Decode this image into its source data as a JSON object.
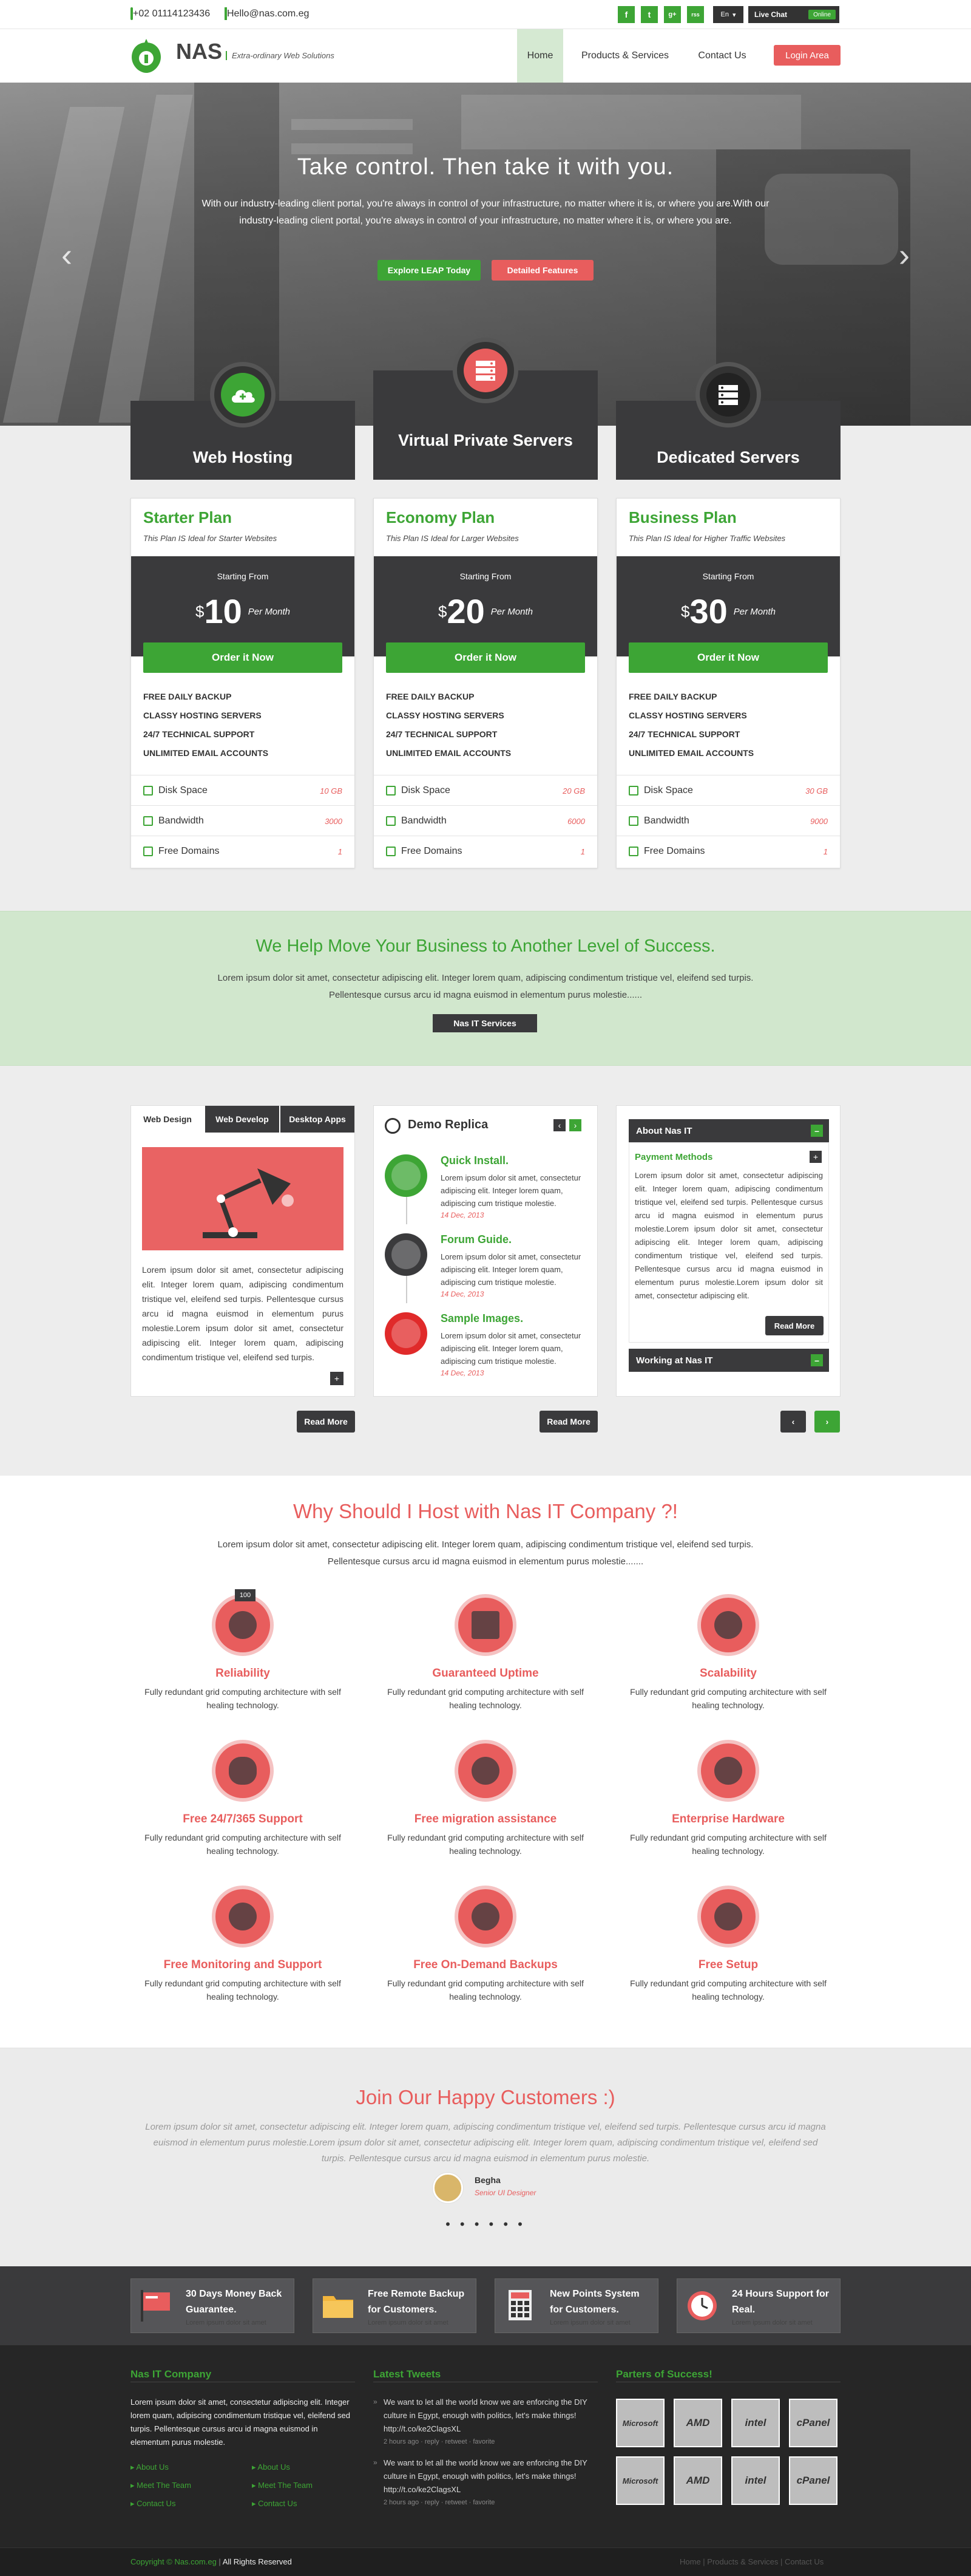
{
  "topbar": {
    "phone": "+02 01114123436",
    "email": "Hello@nas.com.eg",
    "social": [
      "f",
      "t",
      "g+",
      "rss"
    ],
    "language": "En",
    "live_chat": "Live Chat",
    "status": "Online"
  },
  "nav": {
    "logo": "NAS",
    "tagline": "Extra-ordinary Web Solutions",
    "items": [
      "Home",
      "Products & Services",
      "Contact Us"
    ],
    "login": "Login Area"
  },
  "hero": {
    "title": "Take control. Then take it with you.",
    "text": "With our industry-leading client portal, you're always in control of your infrastructure, no matter where it is, or where you are.With our industry-leading client portal, you're always in control of your infrastructure, no matter where it is, or where you are.",
    "btn_primary": "Explore LEAP Today",
    "btn_secondary": "Detailed Features"
  },
  "plans": [
    {
      "category": "Web Hosting",
      "name": "Starter Plan",
      "subtitle": "This Plan IS Ideal for Starter Websites",
      "starting_from": "Starting From",
      "currency": "$",
      "price": "10",
      "period": "Per Month",
      "order": "Order it Now",
      "features": [
        "FREE DAILY BACKUP",
        "CLASSY HOSTING SERVERS",
        "24/7 TECHNICAL SUPPORT",
        "UNLIMITED EMAIL ACCOUNTS"
      ],
      "specs": [
        {
          "label": "Disk Space",
          "value": "10 GB"
        },
        {
          "label": "Bandwidth",
          "value": "3000"
        },
        {
          "label": "Free Domains",
          "value": "1"
        }
      ]
    },
    {
      "category": "Virtual Private Servers",
      "name": "Economy Plan",
      "subtitle": "This Plan IS Ideal for Larger Websites",
      "starting_from": "Starting From",
      "currency": "$",
      "price": "20",
      "period": "Per Month",
      "order": "Order it Now",
      "features": [
        "FREE DAILY BACKUP",
        "CLASSY HOSTING SERVERS",
        "24/7 TECHNICAL SUPPORT",
        "UNLIMITED EMAIL ACCOUNTS"
      ],
      "specs": [
        {
          "label": "Disk Space",
          "value": "20 GB"
        },
        {
          "label": "Bandwidth",
          "value": "6000"
        },
        {
          "label": "Free Domains",
          "value": "1"
        }
      ]
    },
    {
      "category": "Dedicated Servers",
      "name": "Business Plan",
      "subtitle": "This Plan IS Ideal for Higher Traffic Websites",
      "starting_from": "Starting From",
      "currency": "$",
      "price": "30",
      "period": "Per Month",
      "order": "Order it Now",
      "features": [
        "FREE DAILY BACKUP",
        "CLASSY HOSTING SERVERS",
        "24/7 TECHNICAL SUPPORT",
        "UNLIMITED EMAIL ACCOUNTS"
      ],
      "specs": [
        {
          "label": "Disk Space",
          "value": "30 GB"
        },
        {
          "label": "Bandwidth",
          "value": "9000"
        },
        {
          "label": "Free Domains",
          "value": "1"
        }
      ]
    }
  ],
  "band": {
    "title": "We Help Move Your Business to Another Level of Success.",
    "text": "Lorem ipsum dolor sit amet, consectetur adipiscing elit. Integer lorem quam, adipiscing condimentum tristique vel, eleifend sed turpis. Pellentesque cursus arcu id magna euismod in elementum purus molestie......",
    "button": "Nas IT  Services"
  },
  "tabs": {
    "labels": [
      "Web Design",
      "Web Develop",
      "Desktop Apps"
    ],
    "text": "Lorem ipsum dolor sit amet, consectetur adipiscing elit. Integer lorem quam, adipiscing condimentum tristique vel, eleifend sed turpis. Pellentesque cursus arcu id magna euismod in elementum purus molestie.Lorem ipsum dolor sit amet, consectetur adipiscing elit. Integer lorem quam, adipiscing condimentum tristique vel, eleifend sed turpis.",
    "plus": "+",
    "read_more": "Read More"
  },
  "demo": {
    "title": "Demo Replica",
    "prev": "‹",
    "next": "›",
    "items": [
      {
        "title": "Quick Install.",
        "text": "Lorem ipsum dolor sit amet, consectetur adipiscing elit. Integer lorem quam, adipiscing cum tristique molestie.",
        "date": "14 Dec, 2013"
      },
      {
        "title": "Forum Guide.",
        "text": "Lorem ipsum dolor sit amet, consectetur adipiscing elit. Integer lorem quam, adipiscing cum tristique molestie.",
        "date": "14 Dec, 2013"
      },
      {
        "title": "Sample Images.",
        "text": "Lorem ipsum dolor sit amet, consectetur adipiscing elit. Integer lorem quam, adipiscing cum tristique molestie.",
        "date": "14 Dec, 2013"
      }
    ],
    "read_more": "Read More"
  },
  "about": {
    "head": "About Nas IT",
    "minus": "–",
    "sub": "Payment Methods",
    "plus": "+",
    "text": "Lorem ipsum dolor sit amet, consectetur adipiscing elit. Integer lorem quam, adipiscing condimentum tristique vel, eleifend sed turpis. Pellentesque cursus arcu id magna euismod in elementum purus molestie.Lorem ipsum dolor sit amet, consectetur adipiscing elit. Integer lorem quam, adipiscing condimentum tristique vel, eleifend sed turpis. Pellentesque cursus arcu id magna euismod in elementum purus molestie.Lorem ipsum dolor sit amet, consectetur adipiscing elit.",
    "read_more": "Read More",
    "working": "Working at Nas IT",
    "prev": "‹",
    "next": "›"
  },
  "why": {
    "title": "Why Should I Host with Nas IT Company ?!",
    "text": "Lorem ipsum dolor sit amet, consectetur adipiscing elit. Integer lorem quam, adipiscing condimentum tristique vel, eleifend sed turpis. Pellentesque cursus arcu id magna euismod in elementum purus molestie.......",
    "badge": "100",
    "items": [
      {
        "title": "Reliability",
        "text": "Fully redundant grid computing architecture with self healing technology.",
        "icon": "gauge-icon"
      },
      {
        "title": "Guaranteed Uptime",
        "text": "Fully redundant grid computing architecture with self healing technology.",
        "icon": "clipboard-icon"
      },
      {
        "title": "Scalability",
        "text": "Fully redundant grid computing architecture with self healing technology.",
        "icon": "refresh-icon"
      },
      {
        "title": "Free 24/7/365 Support",
        "text": "Fully redundant grid computing architecture with self healing technology.",
        "icon": "microphone-icon"
      },
      {
        "title": "Free migration assistance",
        "text": "Fully redundant grid computing architecture with self healing technology.",
        "icon": "compass-icon"
      },
      {
        "title": "Enterprise Hardware",
        "text": "Fully redundant grid computing architecture with self healing technology.",
        "icon": "gear-icon"
      },
      {
        "title": "Free Monitoring and Support",
        "text": "Fully redundant grid computing architecture with self healing technology.",
        "icon": "lifebuoy-icon"
      },
      {
        "title": "Free On-Demand Backups",
        "text": "Fully redundant grid computing architecture with self healing technology.",
        "icon": "share-icon"
      },
      {
        "title": "Free Setup",
        "text": "Fully redundant grid computing architecture with self healing technology.",
        "icon": "timer-icon"
      }
    ]
  },
  "customers": {
    "title": "Join Our Happy Customers :)",
    "text": "Lorem ipsum dolor sit amet, consectetur adipiscing elit. Integer lorem quam, adipiscing condimentum tristique vel, eleifend sed turpis. Pellentesque cursus arcu id magna euismod in elementum purus molestie.Lorem ipsum dolor sit amet, consectetur adipiscing elit. Integer lorem quam, adipiscing condimentum tristique vel, eleifend sed turpis. Pellentesque cursus arcu id magna euismod in elementum purus molestie.",
    "name": "Begha",
    "role": "Senior UI Designer",
    "dots": "• • • • • •"
  },
  "features_strip": [
    {
      "title": "30 Days Money Back Guarantee.",
      "sub": "Lorem ipsum dolor sit amet"
    },
    {
      "title": "Free Remote Backup for Customers.",
      "sub": "Lorem ipsum dolor sit amet"
    },
    {
      "title": "New Points System for Customers.",
      "sub": "Lorem ipsum dolor sit amet"
    },
    {
      "title": "24 Hours Support for Real.",
      "sub": "Lorem ipsum dolor sit amet"
    }
  ],
  "footer": {
    "company_head": "Nas IT Company",
    "company_text": "Lorem ipsum dolor sit amet, consectetur adipiscing elit. Integer lorem quam, adipiscing condimentum tristique vel, eleifend sed turpis. Pellentesque cursus arcu id magna euismod in elementum purus molestie.",
    "links_left": [
      "About Us",
      "Meet The Team",
      "Contact Us"
    ],
    "links_right": [
      "About Us",
      "Meet The Team",
      "Contact Us"
    ],
    "tweets_head": "Latest Tweets",
    "tweets": [
      {
        "text": "We want to let all the world know we are enforcing the DIY culture in Egypt, enough with politics, let's make things! http://t.co/ke2ClagsXL",
        "meta": "2 hours ago · reply · retweet · favorite"
      },
      {
        "text": "We want to let all the world know we are enforcing the DIY culture in Egypt, enough with politics, let's make things! http://t.co/ke2ClagsXL",
        "meta": "2 hours ago · reply · retweet · favorite"
      }
    ],
    "partners_head": "Parters of Success!",
    "partners": [
      "Microsoft",
      "AMD",
      "intel",
      "cPanel",
      "Microsoft",
      "AMD",
      "intel",
      "cPanel"
    ],
    "copyright": "Copyright © Nas.com.eg",
    "rights": "All Rights Reserved",
    "bottom_links": [
      "Home",
      "Products & Services",
      "Contact Us"
    ]
  },
  "colors": {
    "green": "#3da535",
    "red": "#e85d5d",
    "dark": "#3a3a3c"
  }
}
